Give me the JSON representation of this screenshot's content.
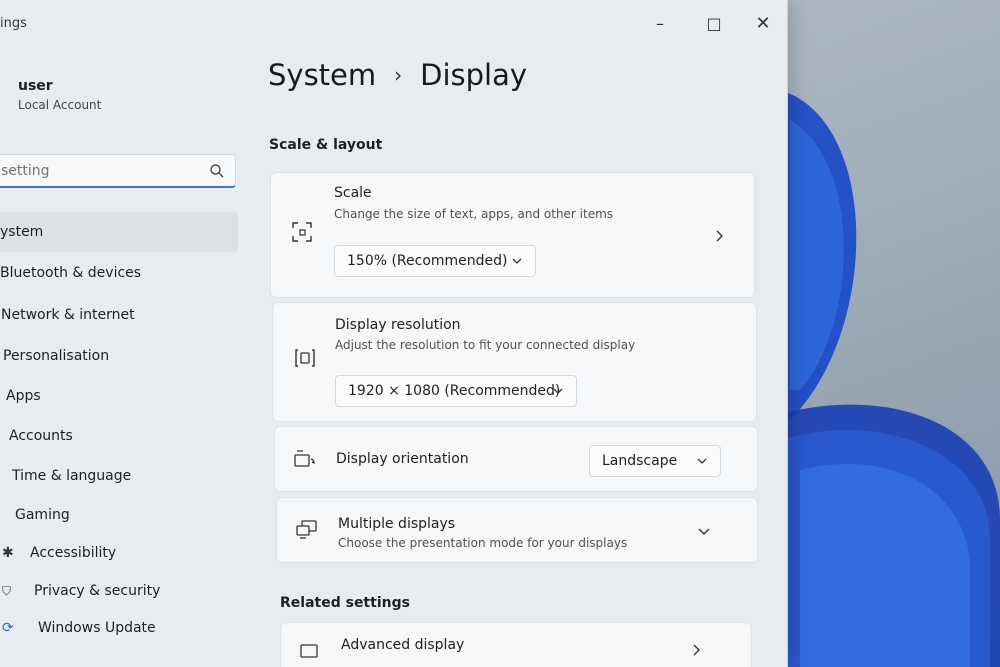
{
  "window": {
    "app_title": "ings",
    "controls": {
      "minimize": "–",
      "maximize": "□",
      "close": "✕"
    }
  },
  "profile": {
    "name": "user",
    "account_type": "Local Account"
  },
  "search": {
    "placeholder": "setting"
  },
  "sidebar": {
    "items": [
      {
        "label": "ystem",
        "active": true
      },
      {
        "label": "Bluetooth & devices"
      },
      {
        "label": "Network & internet"
      },
      {
        "label": "Personalisation"
      },
      {
        "label": "Apps"
      },
      {
        "label": "Accounts"
      },
      {
        "label": "Time & language"
      },
      {
        "label": "Gaming"
      },
      {
        "label": "Accessibility"
      },
      {
        "label": "Privacy & security"
      },
      {
        "label": "Windows Update"
      }
    ]
  },
  "header": {
    "section": "System",
    "page": "Display",
    "separator": "›"
  },
  "scale_layout": {
    "heading": "Scale & layout",
    "scale": {
      "title": "Scale",
      "description": "Change the size of text, apps, and other items",
      "value": "150% (Recommended)"
    },
    "resolution": {
      "title": "Display resolution",
      "description": "Adjust the resolution to fit your connected display",
      "value": "1920 × 1080 (Recommended)"
    },
    "orientation": {
      "title": "Display orientation",
      "value": "Landscape"
    },
    "multiple": {
      "title": "Multiple displays",
      "description": "Choose the presentation mode for your displays"
    }
  },
  "related": {
    "heading": "Related settings",
    "advanced_display": "Advanced display"
  },
  "colors": {
    "accent": "#4a73b8",
    "window_bg": "#e9ecef",
    "card_bg": "#f6f7f8",
    "wallpaper_blue": "#1747c8"
  }
}
